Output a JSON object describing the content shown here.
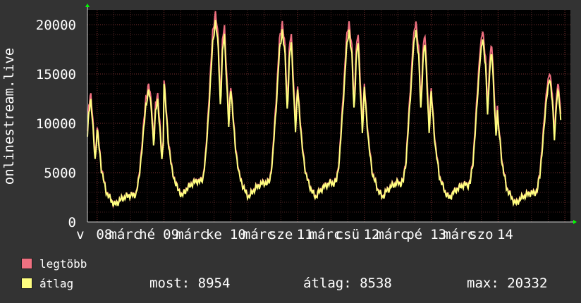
{
  "chart_data": {
    "type": "line",
    "ylabel": "onlinestream.live",
    "ylim": [
      0,
      21500
    ],
    "yticks": [
      "0",
      "5000",
      "10000",
      "15000",
      "20000"
    ],
    "ytick_values": [
      0,
      5000,
      10000,
      15000,
      20000
    ],
    "xticks": [
      "v 08",
      "hé 09",
      "ke 10",
      "sze 11",
      "csü 12",
      "pé 13",
      "szo 14"
    ],
    "xtick_day_labels": [
      "v",
      "hé",
      "ke",
      "sze",
      "csü",
      "pé",
      "szo"
    ],
    "xtick_day_numbers": [
      "08",
      "09",
      "10",
      "11",
      "12",
      "13",
      "14"
    ],
    "month_marker": "márc",
    "grid": true,
    "legend_placement": "bottom-left",
    "colors": {
      "background": "#333333",
      "plot_background": "#000000",
      "grid": "#5a2a2a",
      "axis": "#cccccc",
      "arrow": "#00ff00",
      "max_series": "#f07080",
      "avg_series": "#ffff80"
    },
    "series": [
      {
        "name": "legtöbb",
        "color": "#f07080"
      },
      {
        "name": "átlag",
        "color": "#ffff80"
      }
    ],
    "day_profile": [
      {
        "h": 0,
        "avg": 13000,
        "max": 13300
      },
      {
        "h": 1.5,
        "avg": 7500,
        "max": 7800
      },
      {
        "h": 3,
        "avg": 4500,
        "max": 4600
      },
      {
        "h": 5,
        "avg": 3000,
        "max": 3050
      },
      {
        "h": 6.5,
        "avg": 2400,
        "max": 2450
      },
      {
        "h": 8,
        "avg": 3000,
        "max": 3050
      },
      {
        "h": 10,
        "avg": 3500,
        "max": 3550
      },
      {
        "h": 12,
        "avg": 3800,
        "max": 3850
      },
      {
        "h": 13,
        "avg": 3700,
        "max": 3750
      },
      {
        "h": 14,
        "avg": 4000,
        "max": 4100
      },
      {
        "h": 15,
        "avg": 6000,
        "max": 6300
      },
      {
        "h": 16.5,
        "avg": 12000,
        "max": 12800
      },
      {
        "h": 17.5,
        "avg": 16500,
        "max": 17500
      },
      {
        "h": 18.5,
        "avg": 18500,
        "max": 19300
      },
      {
        "h": 19.5,
        "avg": 16000,
        "max": 16800
      },
      {
        "h": 20.3,
        "avg": 10500,
        "max": 11200
      },
      {
        "h": 21,
        "avg": 15500,
        "max": 16500
      },
      {
        "h": 21.7,
        "avg": 17500,
        "max": 18300
      },
      {
        "h": 22.5,
        "avg": 13000,
        "max": 13800
      },
      {
        "h": 23.3,
        "avg": 8500,
        "max": 9200
      },
      {
        "h": 24,
        "avg": 13000,
        "max": 13300
      }
    ],
    "day_scale": [
      0.72,
      0.72,
      1.1,
      1.05,
      1.05,
      1.05,
      1.0,
      0.78
    ],
    "last_value_hours": 166.5
  },
  "legend": {
    "max_label": "legtöbb",
    "avg_label": "átlag"
  },
  "stats": {
    "now": "most: 8954",
    "avg": "átlag: 8538",
    "max": "max: 20332"
  }
}
